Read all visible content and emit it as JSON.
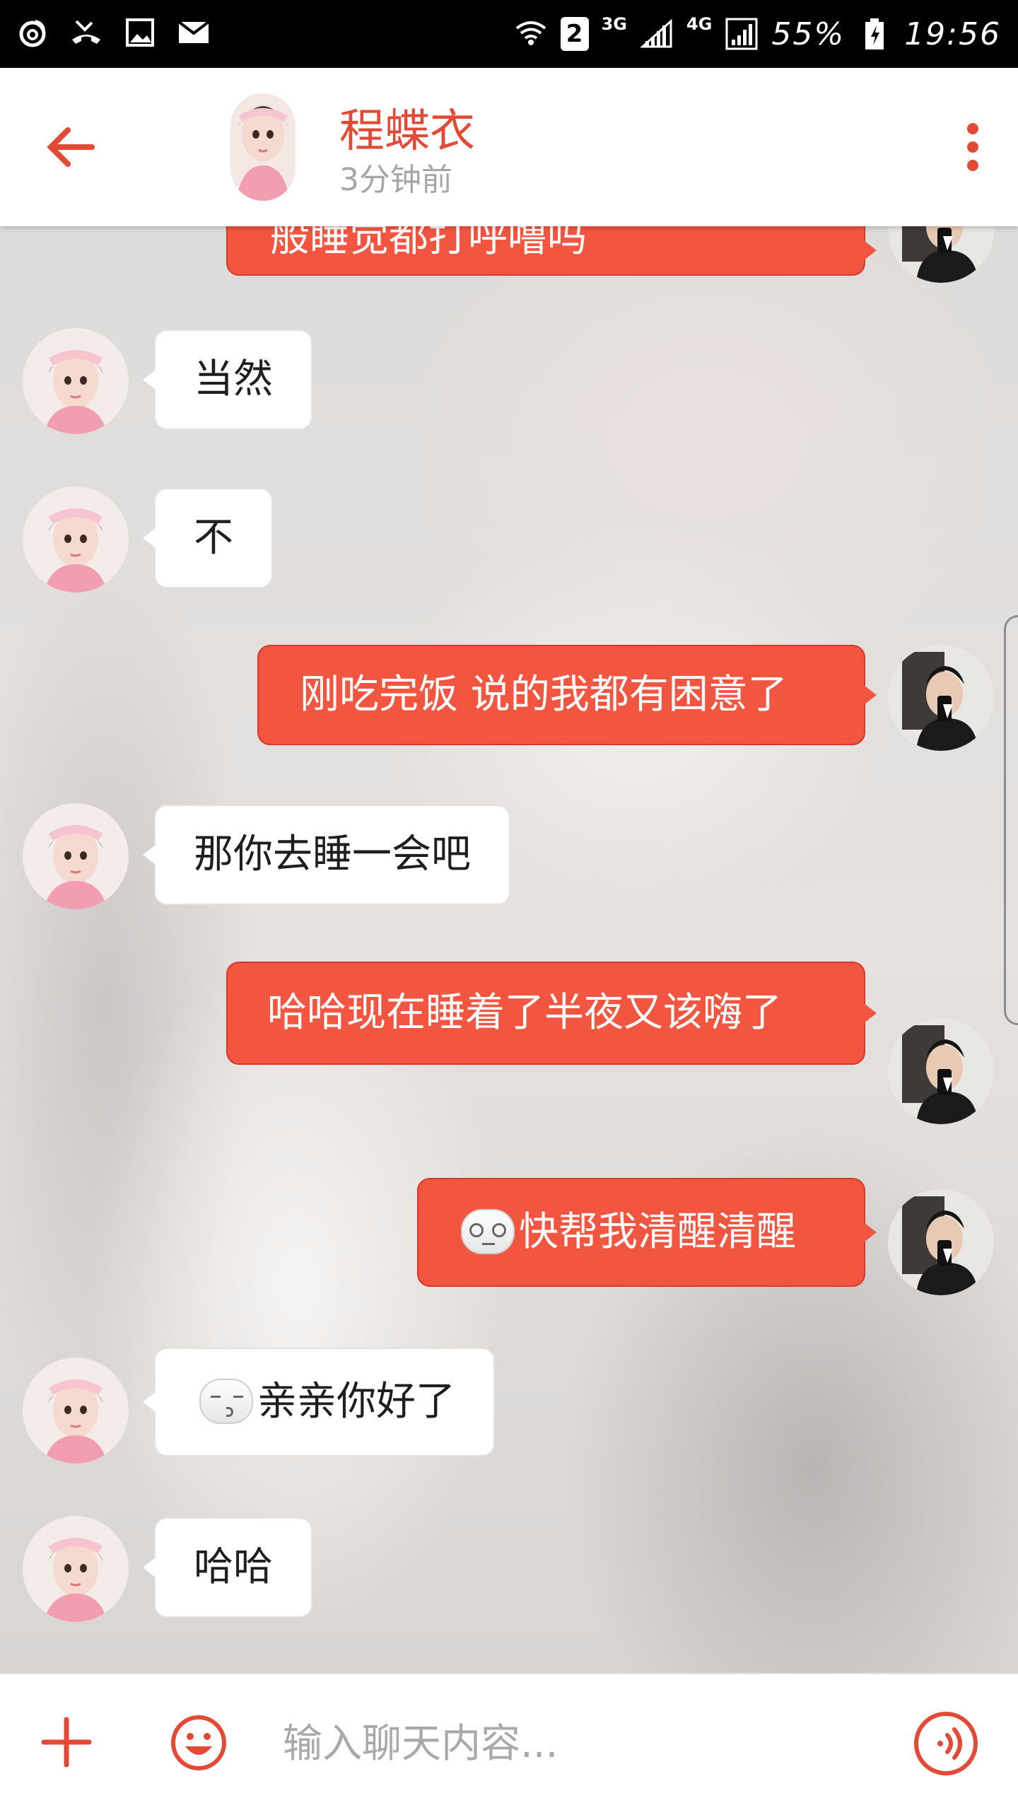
{
  "status_bar": {
    "battery": "55%",
    "time": "19:56",
    "sim_slot": "2",
    "net_3g": "3G",
    "net_4g": "4G",
    "left_icons": [
      "weibo-icon",
      "missed-call-icon",
      "image-icon",
      "mail-icon"
    ],
    "right_icons": [
      "wifi-icon",
      "sim-icon",
      "signal-icon",
      "signal-icon",
      "battery-icon"
    ]
  },
  "header": {
    "contact_name": "程蝶衣",
    "last_seen": "3分钟前",
    "accent_color": "#e24a36"
  },
  "messages": [
    {
      "side": "out",
      "text": "般睡觉都打呼噜吗",
      "partial": true
    },
    {
      "side": "in",
      "text": "当然"
    },
    {
      "side": "in",
      "text": "不"
    },
    {
      "side": "out",
      "text": "刚吃完饭 说的我都有困意了"
    },
    {
      "side": "in",
      "text": "那你去睡一会吧"
    },
    {
      "side": "out",
      "text": "哈哈现在睡着了半夜又该嗨了"
    },
    {
      "side": "out",
      "emoji": "dizzy-face-emoji",
      "text": "快帮我清醒清醒"
    },
    {
      "side": "in",
      "emoji": "kiss-face-emoji",
      "text": "亲亲你好了"
    },
    {
      "side": "in",
      "text": "哈哈"
    }
  ],
  "composer": {
    "placeholder": "输入聊天内容...",
    "value": ""
  },
  "colors": {
    "outgoing_bubble": "#f25640",
    "incoming_bubble": "#ffffff",
    "accent": "#e24a36"
  }
}
